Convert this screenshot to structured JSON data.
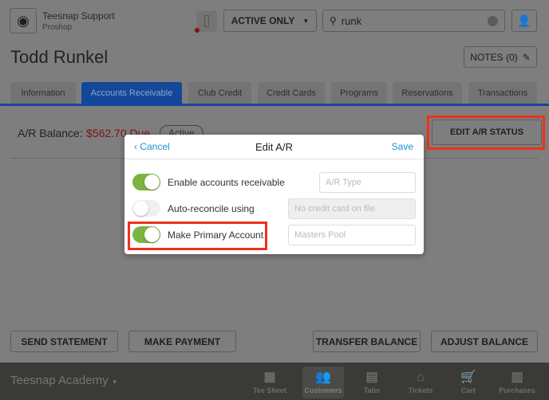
{
  "header": {
    "user_name": "Teesnap Support",
    "user_role": "Proshop",
    "filter": "ACTIVE ONLY",
    "search_value": "runk"
  },
  "customer": {
    "name": "Todd Runkel",
    "notes_label": "NOTES (0)"
  },
  "tabs": [
    {
      "label": "Information"
    },
    {
      "label": "Accounts Receivable",
      "active": true
    },
    {
      "label": "Club Credit"
    },
    {
      "label": "Credit Cards"
    },
    {
      "label": "Programs"
    },
    {
      "label": "Reservations"
    },
    {
      "label": "Transactions"
    }
  ],
  "ar": {
    "balance_label": "A/R Balance:",
    "balance_value": "$562.70 Due",
    "status": "Active",
    "edit_status_label": "EDIT A/R STATUS"
  },
  "modal": {
    "cancel": "Cancel",
    "title": "Edit A/R",
    "save": "Save",
    "rows": [
      {
        "label": "Enable accounts receivable",
        "on": true,
        "field": "A/R Type"
      },
      {
        "label": "Auto-reconcile using",
        "on": false,
        "field": "No credit card on file"
      },
      {
        "label": "Make Primary Account",
        "on": true,
        "field": "Masters Pool"
      }
    ]
  },
  "actions": {
    "send_statement": "SEND STATEMENT",
    "make_payment": "MAKE PAYMENT",
    "transfer_balance": "TRANSFER BALANCE",
    "adjust_balance": "ADJUST BALANCE"
  },
  "bottom": {
    "course": "Teesnap Academy",
    "nav": [
      {
        "label": "Tee Sheet",
        "icon": "calendar-icon"
      },
      {
        "label": "Customers",
        "icon": "people-icon",
        "active": true
      },
      {
        "label": "Tabs",
        "icon": "tabs-icon"
      },
      {
        "label": "Tickets",
        "icon": "bell-icon"
      },
      {
        "label": "Cart",
        "icon": "cart-icon"
      },
      {
        "label": "Purchases",
        "icon": "register-icon"
      }
    ]
  },
  "colors": {
    "accent": "#1a5bbf",
    "highlight": "#f0311a",
    "toggle_on": "#7cb441",
    "due": "#8a1a1a"
  }
}
